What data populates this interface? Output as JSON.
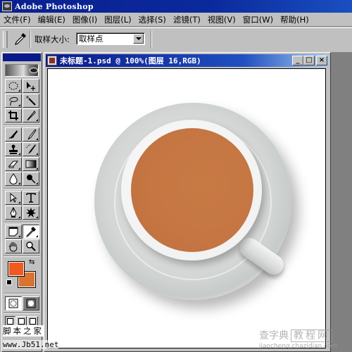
{
  "window": {
    "title": "Adobe Photoshop",
    "icon": "photoshop-eye-icon"
  },
  "menu": [
    {
      "label": "文件(F)"
    },
    {
      "label": "编辑(E)"
    },
    {
      "label": "图像(I)"
    },
    {
      "label": "图层(L)"
    },
    {
      "label": "选择(S)"
    },
    {
      "label": "滤镜(T)"
    },
    {
      "label": "视图(V)"
    },
    {
      "label": "窗口(W)"
    },
    {
      "label": "帮助(H)"
    }
  ],
  "options_bar": {
    "tool_icon": "eyedropper-icon",
    "sample_size_label": "取样大小:",
    "sample_size_value": "取样点"
  },
  "toolbox": {
    "tools": [
      {
        "name": "marquee-tool",
        "icon": "dotted-ellipse-icon"
      },
      {
        "name": "move-tool",
        "icon": "move-arrow-icon"
      },
      {
        "name": "lasso-tool",
        "icon": "lasso-icon"
      },
      {
        "name": "magic-wand-tool",
        "icon": "magic-wand-icon"
      },
      {
        "name": "crop-tool",
        "icon": "crop-icon"
      },
      {
        "name": "slice-tool",
        "icon": "slice-knife-icon"
      },
      {
        "name": "healing-brush-tool",
        "icon": "bandage-icon"
      },
      {
        "name": "brush-tool",
        "icon": "brush-icon"
      },
      {
        "name": "clone-stamp-tool",
        "icon": "stamp-icon"
      },
      {
        "name": "history-brush-tool",
        "icon": "history-brush-icon"
      },
      {
        "name": "eraser-tool",
        "icon": "eraser-icon"
      },
      {
        "name": "gradient-tool",
        "icon": "gradient-icon"
      },
      {
        "name": "blur-tool",
        "icon": "drop-icon"
      },
      {
        "name": "dodge-tool",
        "icon": "dodge-icon"
      },
      {
        "name": "path-selection-tool",
        "icon": "arrow-select-icon"
      },
      {
        "name": "type-tool",
        "icon": "type-t-icon"
      },
      {
        "name": "pen-tool",
        "icon": "pen-nib-icon"
      },
      {
        "name": "shape-tool",
        "icon": "starburst-icon"
      },
      {
        "name": "notes-tool",
        "icon": "note-icon"
      },
      {
        "name": "eyedropper-tool",
        "icon": "eyedropper-icon",
        "active": true
      },
      {
        "name": "hand-tool",
        "icon": "hand-icon"
      },
      {
        "name": "zoom-tool",
        "icon": "magnifier-icon"
      }
    ],
    "foreground_color": "#f05a1e",
    "background_color": "#d9732f"
  },
  "document": {
    "title": "未标题-1.psd @ 100%(图层 16,RGB)",
    "zoom": "100%",
    "layer": "图层 16",
    "mode": "RGB",
    "minimize_label": "_",
    "maximize_label": "□",
    "close_label": "×"
  },
  "watermarks": {
    "site_cn": "脚本之家",
    "site_url": "www.Jb51.net",
    "brand_left": "查字典",
    "brand_box": "教程网",
    "brand_url": "jiaocheng.chazidian.com"
  }
}
